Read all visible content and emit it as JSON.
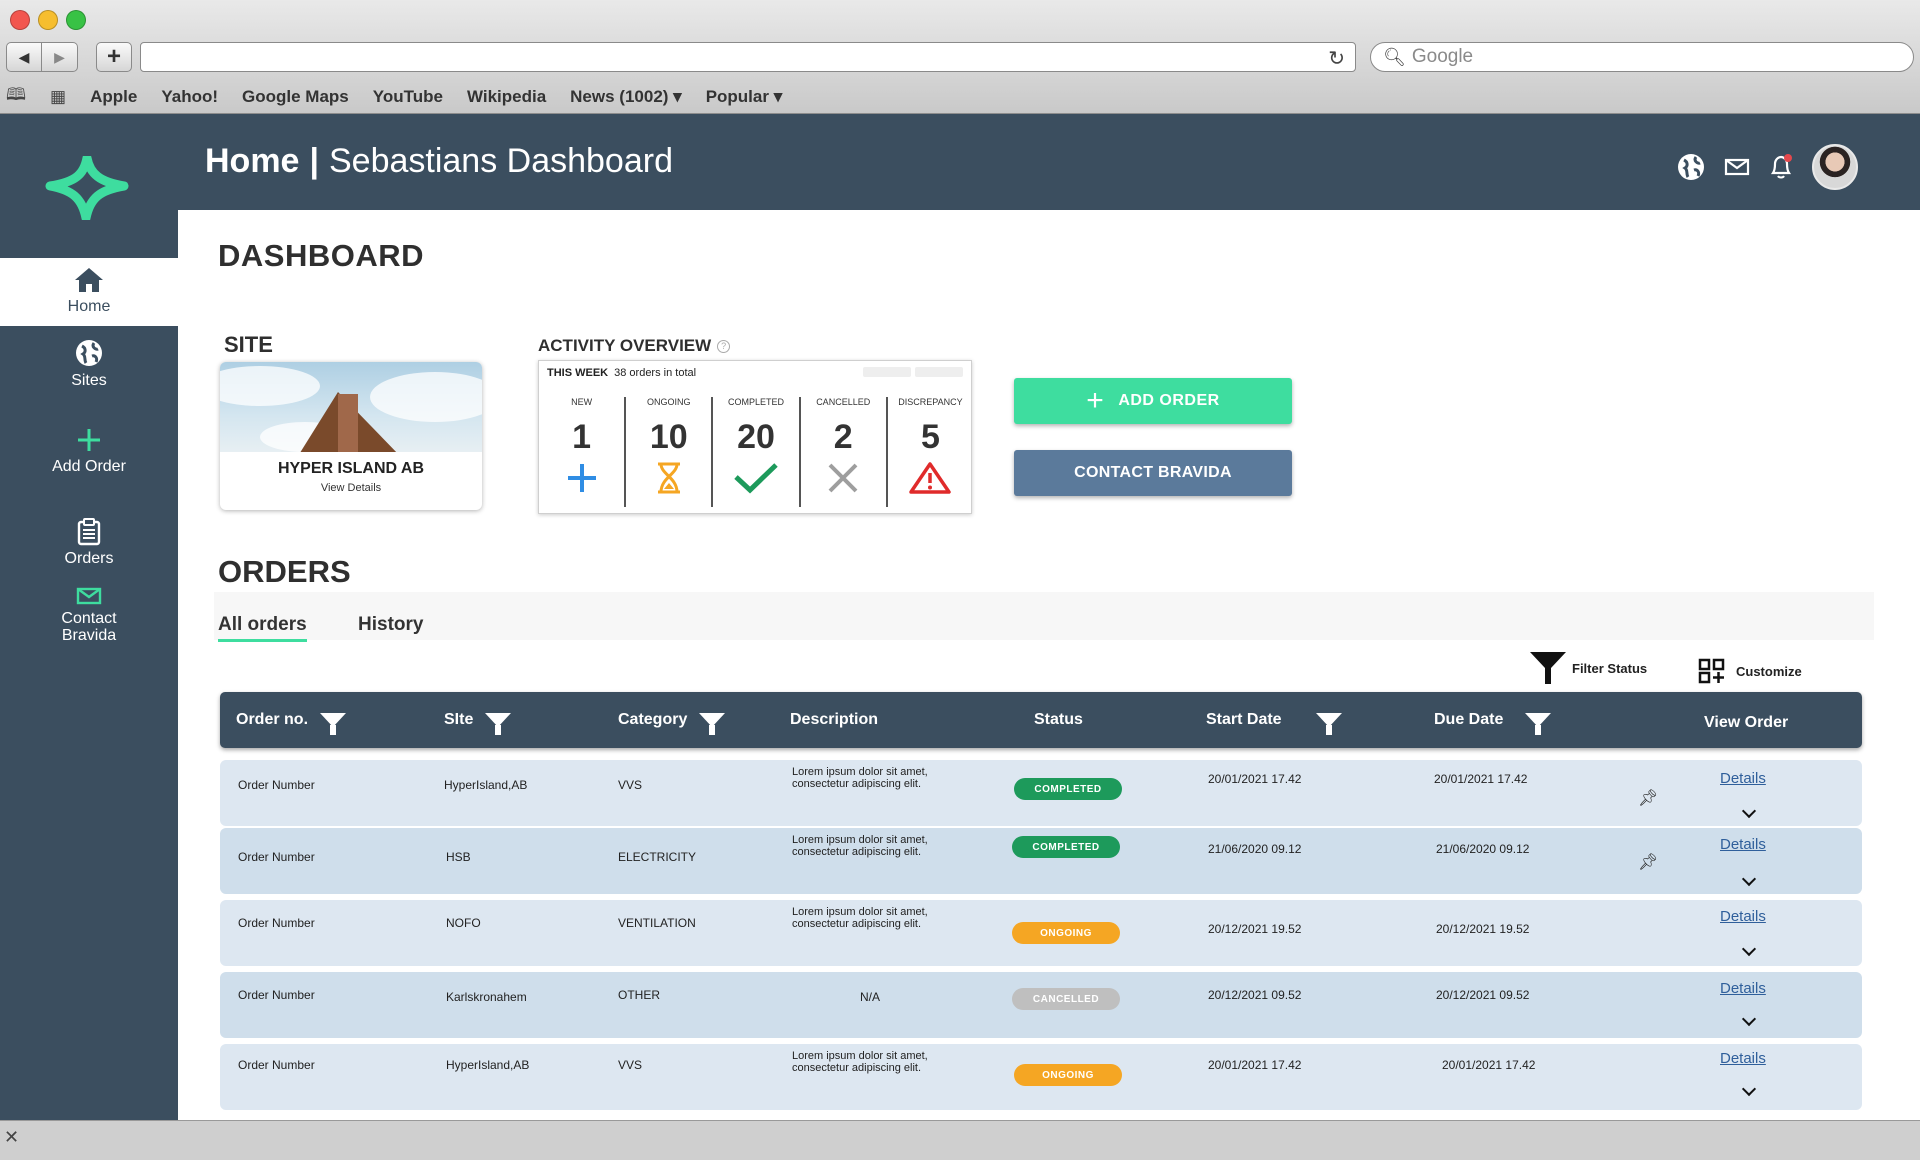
{
  "browser": {
    "search_placeholder": "Google",
    "bookmarks": [
      "Apple",
      "Yahoo!",
      "Google Maps",
      "YouTube",
      "Wikipedia",
      "News (1002) ▾",
      "Popular ▾"
    ]
  },
  "header": {
    "home": "Home",
    "separator": "|",
    "dashboard_name": "Sebastians Dashboard"
  },
  "sidebar": {
    "items": [
      {
        "label": "Home"
      },
      {
        "label": "Sites"
      },
      {
        "label": "Add Order"
      },
      {
        "label": "Orders"
      },
      {
        "label": "Contact\nBravida"
      }
    ]
  },
  "main": {
    "title": "DASHBOARD",
    "site": {
      "heading": "SITE",
      "name": "HYPER ISLAND AB",
      "view_details": "View Details"
    },
    "activity": {
      "heading": "ACTIVITY OVERVIEW",
      "period": "THIS WEEK",
      "total": "38 orders in total",
      "columns": [
        {
          "label": "NEW",
          "value": "1",
          "icon": "plus-icon"
        },
        {
          "label": "ONGOING",
          "value": "10",
          "icon": "hourglass-icon"
        },
        {
          "label": "COMPLETED",
          "value": "20",
          "icon": "check-icon"
        },
        {
          "label": "CANCELLED",
          "value": "2",
          "icon": "x-icon"
        },
        {
          "label": "DISCREPANCY",
          "value": "5",
          "icon": "warning-icon"
        }
      ]
    },
    "buttons": {
      "add_order": "ADD ORDER",
      "contact": "CONTACT BRAVIDA"
    },
    "orders_heading": "ORDERS",
    "tabs": [
      "All orders",
      "History"
    ],
    "filter_status": "Filter Status",
    "customize": "Customize",
    "table": {
      "columns": [
        "Order no.",
        "SIte",
        "Category",
        "Description",
        "Status",
        "Start Date",
        "Due Date",
        "View Order"
      ],
      "rows": [
        {
          "order": "Order Number",
          "site": "HyperIsland,AB",
          "category": "VVS",
          "description": "Lorem ipsum dolor sit amet, consectetur adipiscing elit.",
          "status": "COMPLETED",
          "start": "20/01/2021  17.42",
          "due": "20/01/2021  17.42",
          "details": "Details",
          "pinned": true
        },
        {
          "order": "Order Number",
          "site": "HSB",
          "category": "ELECTRICITY",
          "description": "Lorem ipsum dolor sit amet, consectetur adipiscing elit.",
          "status": "COMPLETED",
          "start": "21/06/2020  09.12",
          "due": "21/06/2020  09.12",
          "details": "Details",
          "pinned": true
        },
        {
          "order": "Order Number",
          "site": "NOFO",
          "category": "VENTILATION",
          "description": "Lorem ipsum dolor sit amet, consectetur adipiscing elit.",
          "status": "ONGOING",
          "start": "20/12/2021  19.52",
          "due": "20/12/2021  19.52",
          "details": "Details",
          "pinned": false
        },
        {
          "order": "Order Number",
          "site": "Karlskronahem",
          "category": "OTHER",
          "description": "N/A",
          "status": "CANCELLED",
          "start": "20/12/2021  09.52",
          "due": "20/12/2021  09.52",
          "details": "Details",
          "pinned": false
        },
        {
          "order": "Order Number",
          "site": "HyperIsland,AB",
          "category": "VVS",
          "description": "Lorem ipsum dolor sit amet, consectetur adipiscing elit.",
          "status": "ONGOING",
          "start": "20/01/2021  17.42",
          "due": "20/01/2021  17.42",
          "details": "Details",
          "pinned": false
        }
      ]
    }
  },
  "colors": {
    "navy": "#3b4e5f",
    "accent_green": "#3edd9f",
    "contact_blue": "#5b7a9b",
    "completed": "#1d9a5b",
    "ongoing": "#f5a623",
    "cancelled": "#bfbfbf"
  }
}
